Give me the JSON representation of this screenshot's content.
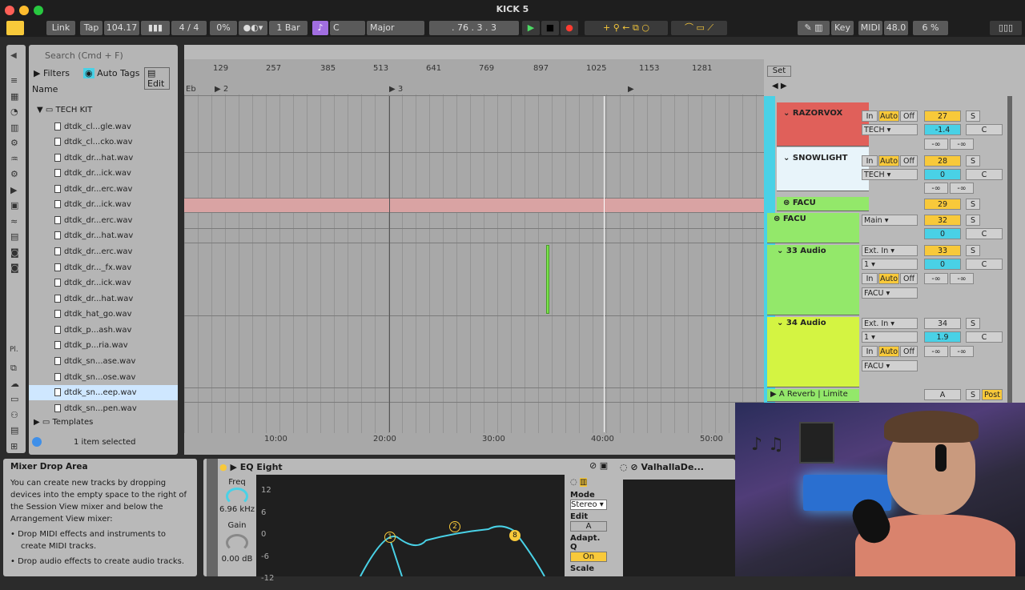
{
  "window": {
    "title": "KICK 5"
  },
  "control_bar": {
    "link": "Link",
    "tap": "Tap",
    "tempo": "104.17",
    "signature": "4 / 4",
    "groove_amount": "0%",
    "quantize": "1 Bar",
    "key": "C",
    "scale": "Major",
    "position": ". 76 .   3 .   3",
    "key_map": "Key",
    "midi_map": "MIDI",
    "sample_rate": "48.0",
    "cpu": "6 %"
  },
  "browser": {
    "search_placeholder": "Search (Cmd + F)",
    "filters": "Filters",
    "auto_tags": "Auto Tags",
    "edit": "Edit",
    "column_header": "Name",
    "folder": "TECH KIT",
    "files": [
      "dtdk_cl...gle.wav",
      "dtdk_cl...cko.wav",
      "dtdk_dr...hat.wav",
      "dtdk_dr...ick.wav",
      "dtdk_dr...erc.wav",
      "dtdk_dr...ick.wav",
      "dtdk_dr...erc.wav",
      "dtdk_dr...hat.wav",
      "dtdk_dr...erc.wav",
      "dtdk_dr..._fx.wav",
      "dtdk_dr...ick.wav",
      "dtdk_dr...hat.wav",
      "dtdk_hat_go.wav",
      "dtdk_p...ash.wav",
      "dtdk_p...ria.wav",
      "dtdk_sn...ase.wav",
      "dtdk_sn...ose.wav",
      "dtdk_sn...eep.wav",
      "dtdk_sn...pen.wav"
    ],
    "templates": "Templates",
    "status": "1 item selected",
    "sidebar_label": "Pl."
  },
  "arrangement": {
    "ruler_bars": [
      "129",
      "257",
      "385",
      "513",
      "641",
      "769",
      "897",
      "1025",
      "1153",
      "1281"
    ],
    "locators": [
      "Eb",
      "2",
      "3"
    ],
    "time_labels": [
      "10:00",
      "20:00",
      "30:00",
      "40:00",
      "50:00"
    ],
    "set_label": "Set"
  },
  "mixer": {
    "tracks": [
      {
        "name": "RAZORVOX",
        "number": "27",
        "routing": "TECH",
        "pan": "-1.4",
        "color": "#e0605a"
      },
      {
        "name": "SNOWLIGHT",
        "number": "28",
        "routing": "TECH",
        "pan": "0",
        "color": "#e8f4fa"
      },
      {
        "name": "FACU",
        "number": "29",
        "color": "#93e86a"
      },
      {
        "name": "FACU",
        "number": "32",
        "routing": "Main",
        "pan": "0",
        "color": "#93e86a"
      },
      {
        "name": "33 Audio",
        "number": "33",
        "input": "Ext. In",
        "channel": "1",
        "out": "FACU",
        "pan": "0",
        "color": "#93e86a"
      },
      {
        "name": "34 Audio",
        "number": "34",
        "input": "Ext. In",
        "channel": "1",
        "out": "FACU",
        "pan": "1.9",
        "color": "#d4f442"
      },
      {
        "name": "A Reverb | Limite",
        "number": "A",
        "post": "Post",
        "color": "#49d1e6"
      }
    ],
    "monitor": {
      "in": "In",
      "auto": "Auto",
      "off": "Off"
    },
    "solo": "S",
    "center": "C",
    "neg_inf": "-∞"
  },
  "info_view": {
    "title": "Mixer Drop Area",
    "body": "You can create new tracks by dropping devices into the empty space to the right of the Session View mixer and below the Arrangement View mixer:",
    "bullets": [
      "Drop MIDI effects and instruments to create MIDI tracks.",
      "Drop audio effects to create audio tracks."
    ]
  },
  "device": {
    "name": "EQ Eight",
    "freq_label": "Freq",
    "freq_value": "6.96 kHz",
    "gain_label": "Gain",
    "gain_value": "0.00 dB",
    "db_ticks": [
      "12",
      "6",
      "0",
      "-6",
      "-12"
    ],
    "mode_label": "Mode",
    "mode_value": "Stereo",
    "edit_label": "Edit",
    "edit_value": "A",
    "adapt_label": "Adapt. Q",
    "adapt_value": "On",
    "scale_label": "Scale",
    "second_device": "ValhallaDe...",
    "band_numbers": [
      "1",
      "2",
      "8"
    ]
  }
}
